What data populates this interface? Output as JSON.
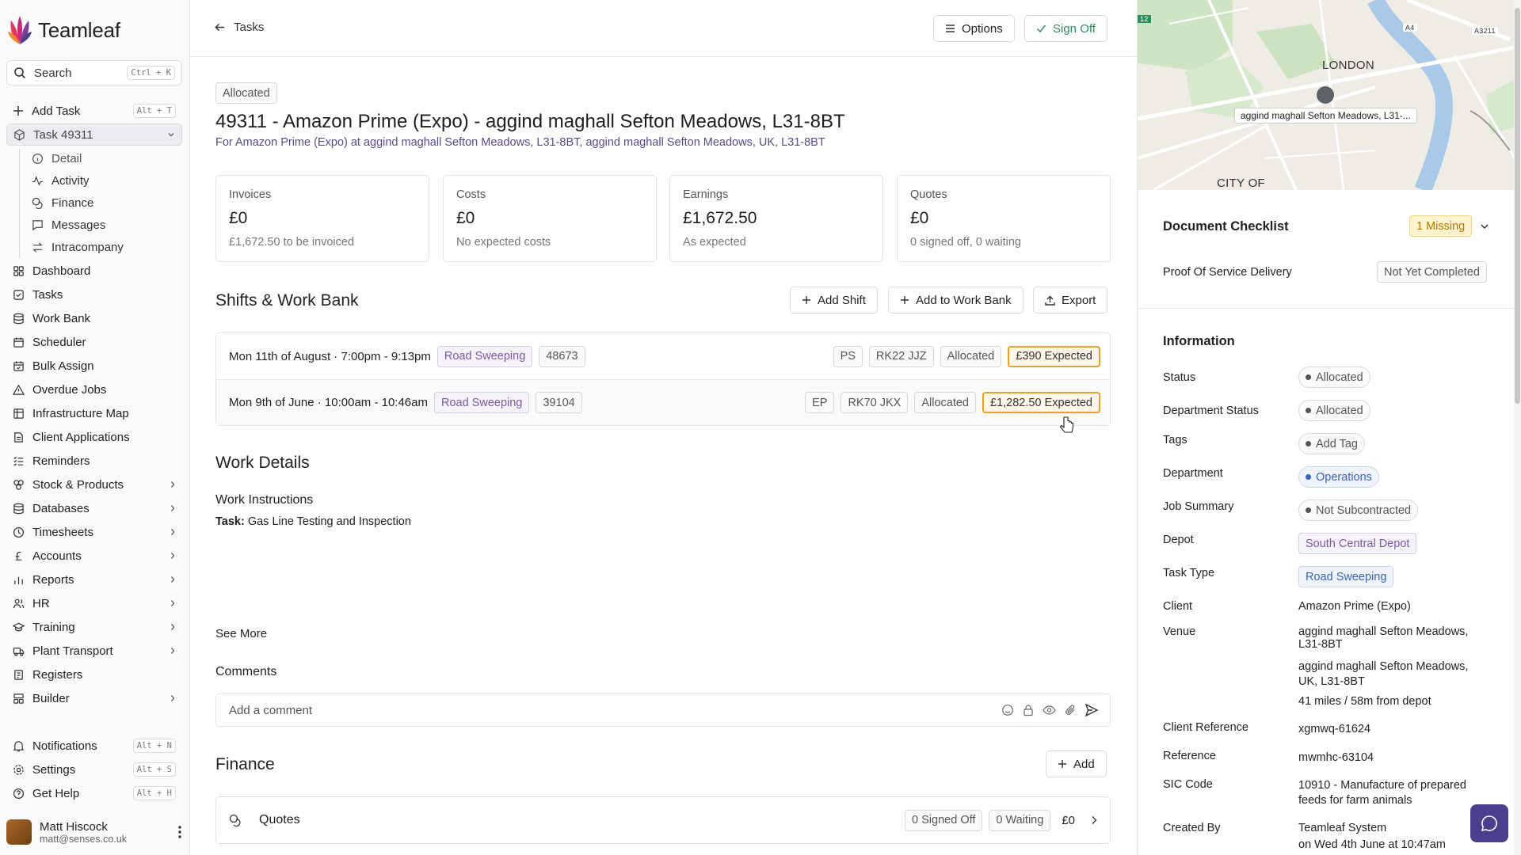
{
  "app": {
    "name": "Teamleaf"
  },
  "search": {
    "label": "Search",
    "shortcut": "Ctrl + K"
  },
  "sidebar": {
    "add_task": {
      "label": "Add Task",
      "shortcut": "Alt + T"
    },
    "current_task": "Task 49311",
    "sub_items": [
      "Detail",
      "Activity",
      "Finance",
      "Messages",
      "Intracompany"
    ],
    "items": [
      "Dashboard",
      "Tasks",
      "Work Bank",
      "Scheduler",
      "Bulk Assign",
      "Overdue Jobs",
      "Infrastructure Map",
      "Client Applications",
      "Reminders",
      "Stock & Products",
      "Databases",
      "Timesheets",
      "Accounts",
      "Reports",
      "HR",
      "Training",
      "Plant Transport",
      "Registers",
      "Builder"
    ],
    "notifications": {
      "label": "Notifications",
      "shortcut": "Alt + N"
    },
    "settings": {
      "label": "Settings",
      "shortcut": "Alt + S"
    },
    "help": {
      "label": "Get Help",
      "shortcut": "Alt + H"
    },
    "user": {
      "name": "Matt Hiscock",
      "email": "matt@senses.co.uk"
    }
  },
  "topbar": {
    "back_label": "Tasks",
    "options_label": "Options",
    "signoff_label": "Sign Off"
  },
  "task": {
    "status": "Allocated",
    "title": "49311 - Amazon Prime (Expo) - aggind maghall Sefton Meadows, L31-8BT",
    "subtitle": "For Amazon Prime (Expo) at aggind maghall Sefton Meadows, L31-8BT, aggind maghall Sefton Meadows, UK, L31-8BT"
  },
  "cards": [
    {
      "label": "Invoices",
      "value": "£0",
      "note": "£1,672.50 to be invoiced"
    },
    {
      "label": "Costs",
      "value": "£0",
      "note": "No expected costs"
    },
    {
      "label": "Earnings",
      "value": "£1,672.50",
      "note": "As expected"
    },
    {
      "label": "Quotes",
      "value": "£0",
      "note": "0 signed off, 0 waiting"
    }
  ],
  "shifts_section": {
    "title": "Shifts & Work Bank",
    "add_shift": "Add Shift",
    "add_work_bank": "Add to Work Bank",
    "export": "Export",
    "rows": [
      {
        "when": "Mon 11th of August · 7:00pm - 9:13pm",
        "type": "Road Sweeping",
        "id": "48673",
        "initials": "PS",
        "vehicle": "RK22 JJZ",
        "status": "Allocated",
        "amount": "£390 Expected"
      },
      {
        "when": "Mon 9th of June · 10:00am - 10:46am",
        "type": "Road Sweeping",
        "id": "39104",
        "initials": "EP",
        "vehicle": "RK70 JKX",
        "status": "Allocated",
        "amount": "£1,282.50 Expected"
      }
    ]
  },
  "work_details": {
    "title": "Work Details",
    "instructions_title": "Work Instructions",
    "task_prefix": "Task:",
    "task_text": "Gas Line Testing and Inspection",
    "see_more": "See More"
  },
  "comments": {
    "title": "Comments",
    "placeholder": "Add a comment"
  },
  "finance": {
    "title": "Finance",
    "add": "Add",
    "quotes": {
      "label": "Quotes",
      "signed_off": "0 Signed Off",
      "waiting": "0 Waiting",
      "amount": "£0"
    }
  },
  "map": {
    "labels": {
      "london": "LONDON",
      "city": "CITY OF",
      "road_a4": "A4",
      "road_a3211": "A3211",
      "road_12": "12"
    },
    "pin_label": "aggind maghall Sefton Meadows, L31-..."
  },
  "checklist": {
    "title": "Document Checklist",
    "badge": "1 Missing",
    "item_label": "Proof Of Service Delivery",
    "item_status": "Not Yet Completed"
  },
  "information": {
    "title": "Information",
    "status": {
      "label": "Status",
      "value": "Allocated"
    },
    "dept_status": {
      "label": "Department Status",
      "value": "Allocated"
    },
    "tags": {
      "label": "Tags",
      "value": "Add Tag"
    },
    "department": {
      "label": "Department",
      "value": "Operations"
    },
    "job_summary": {
      "label": "Job Summary",
      "value": "Not Subcontracted"
    },
    "depot": {
      "label": "Depot",
      "value": "South Central Depot"
    },
    "task_type": {
      "label": "Task Type",
      "value": "Road Sweeping"
    },
    "client": {
      "label": "Client",
      "value": "Amazon Prime (Expo)"
    },
    "venue": {
      "label": "Venue",
      "line1": "aggind maghall Sefton Meadows, L31-8BT",
      "line2": "aggind maghall Sefton Meadows, UK, L31-8BT",
      "distance": "41 miles / 58m from depot"
    },
    "client_ref": {
      "label": "Client Reference",
      "value": "xgmwq-61624"
    },
    "reference": {
      "label": "Reference",
      "value": "mwmhc-63104"
    },
    "sic": {
      "label": "SIC Code",
      "value": "10910 - Manufacture of prepared feeds for farm animals"
    },
    "created_by": {
      "label": "Created By",
      "value": "Teamleaf System",
      "when": "on Wed 4th June at 10:47am"
    }
  },
  "colors": {
    "accent_purple": "#4a3f8f",
    "sign_off_green": "#2f8f5a",
    "warning_orange": "#e4a229"
  }
}
